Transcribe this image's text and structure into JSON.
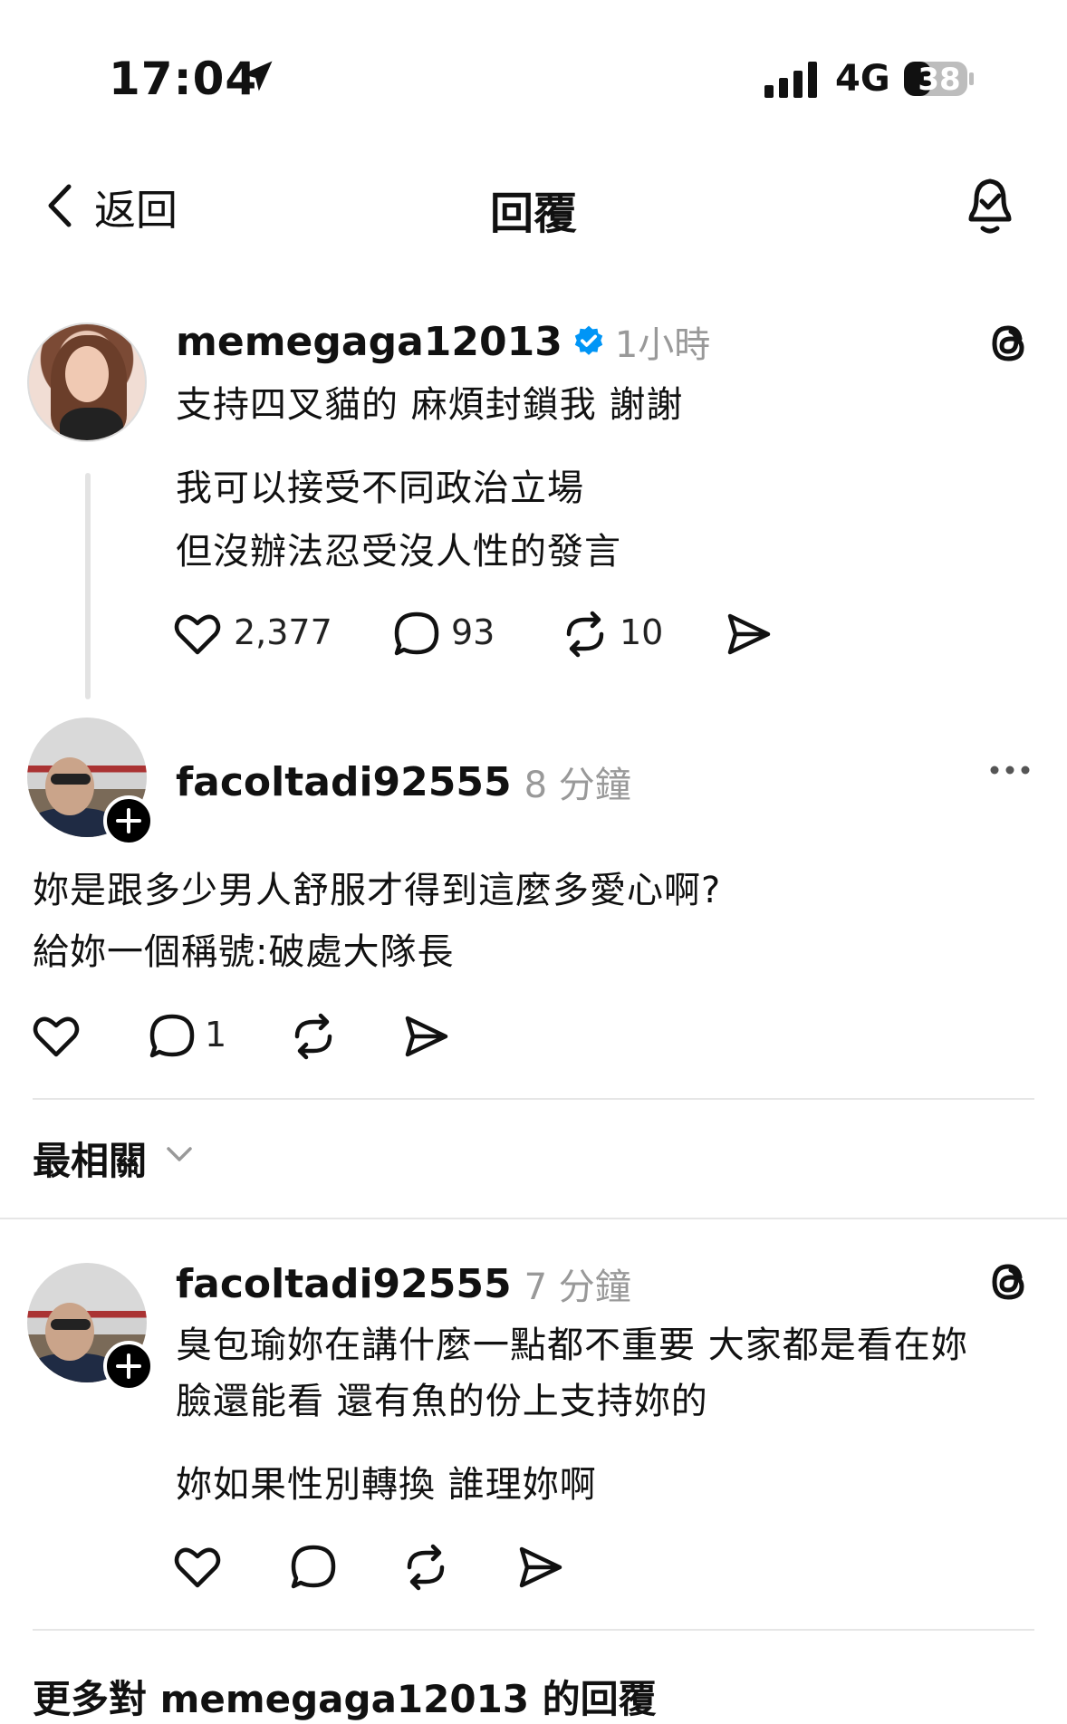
{
  "status_bar": {
    "time": "17:04",
    "network": "4G",
    "battery": "38",
    "icons": [
      "location-arrow-icon",
      "signal-bars-icon",
      "battery-icon"
    ]
  },
  "nav": {
    "back_label": "返回",
    "title": "回覆",
    "icons": [
      "chevron-left-icon",
      "bell-check-icon"
    ]
  },
  "original_post": {
    "username": "memegaga12013",
    "verified": true,
    "time": "1小時",
    "line1": "支持四叉貓的 麻煩封鎖我 謝謝",
    "line2": "我可以接受不同政治立場",
    "line3": "但沒辦法忍受沒人性的發言",
    "likes": "2,377",
    "comments": "93",
    "reposts": "10"
  },
  "reply_1": {
    "username": "facoltadi92555",
    "time": "8 分鐘",
    "line1": "妳是跟多少男人舒服才得到這麼多愛心啊?",
    "line2": "給妳一個稱號:破處大隊長",
    "comments": "1"
  },
  "sort": {
    "label": "最相關"
  },
  "reply_2": {
    "username": "facoltadi92555",
    "time": "7 分鐘",
    "line1": "臭包瑜妳在講什麼一點都不重要 大家都是看在妳",
    "line2": "臉還能看 還有魚的份上支持妳的",
    "line3": "妳如果性別轉換 誰理妳啊"
  },
  "footer": {
    "text": "更多對 memegaga12013 的回覆"
  },
  "colors": {
    "verified_blue": "#0095f6",
    "muted_gray": "#999999",
    "divider": "#e6e6e6"
  }
}
